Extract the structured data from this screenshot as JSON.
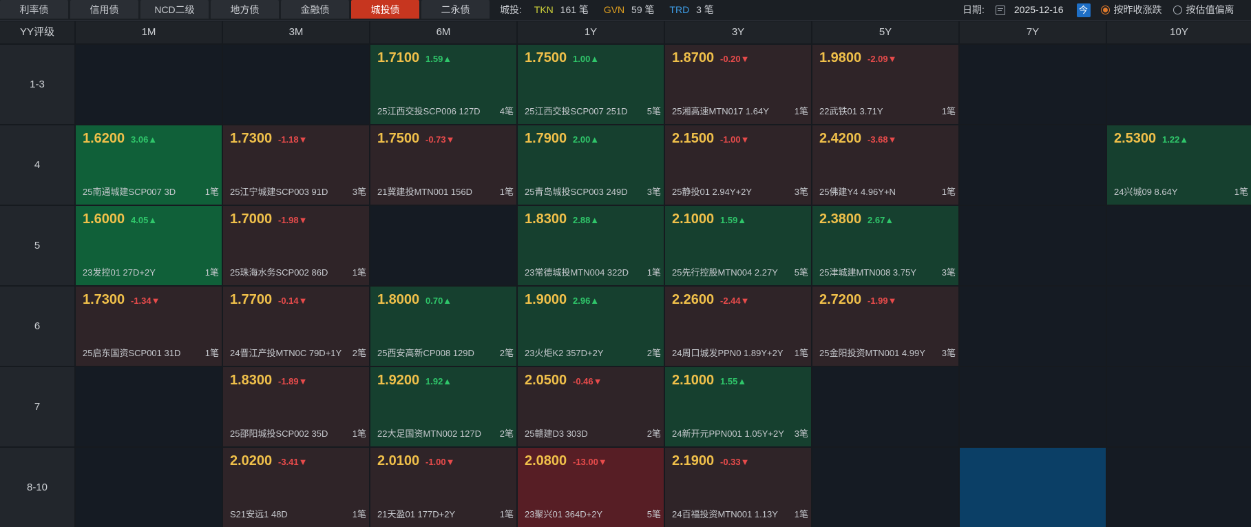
{
  "tabs": [
    {
      "label": "利率债",
      "active": false
    },
    {
      "label": "信用债",
      "active": false
    },
    {
      "label": "NCD二级",
      "active": false
    },
    {
      "label": "地方债",
      "active": false
    },
    {
      "label": "金融债",
      "active": false
    },
    {
      "label": "城投债",
      "active": true
    },
    {
      "label": "二永债",
      "active": false
    }
  ],
  "stats": {
    "label": "城投:",
    "tkn_label": "TKN",
    "tkn_count": "161 笔",
    "gvn_label": "GVN",
    "gvn_count": "59 笔",
    "trd_label": "TRD",
    "trd_count": "3 笔"
  },
  "controls": {
    "date_label": "日期:",
    "date_value": "2025-12-16",
    "today_label": "今",
    "radio_change": "按昨收涨跌",
    "radio_deviation": "按估值偏离",
    "selected_mode": "按昨收涨跌"
  },
  "colors": {
    "active_tab": "#c7361f",
    "yield": "#f0c04a",
    "up": "#2fc66a",
    "down": "#e84b4b",
    "tkn": "#cfd33a",
    "gvn": "#e0a020",
    "trd": "#3e9ee8"
  },
  "grid": {
    "corner_label": "YY评级",
    "columns": [
      "1M",
      "3M",
      "6M",
      "1Y",
      "3Y",
      "5Y",
      "7Y",
      "10Y"
    ],
    "rows": [
      {
        "label": "1-3",
        "cells": [
          null,
          null,
          {
            "yield": "1.7100",
            "change": "1.59▲",
            "dir": "up",
            "bond": "25江西交投SCP006 127D",
            "deals": "4笔"
          },
          {
            "yield": "1.7500",
            "change": "1.00▲",
            "dir": "up",
            "bond": "25江西交投SCP007 251D",
            "deals": "5笔"
          },
          {
            "yield": "1.8700",
            "change": "-0.20▼",
            "dir": "down",
            "bond": "25湘高速MTN017 1.64Y",
            "deals": "1笔"
          },
          {
            "yield": "1.9800",
            "change": "-2.09▼",
            "dir": "down",
            "bond": "22武铁01 3.71Y",
            "deals": "1笔"
          },
          null,
          null
        ]
      },
      {
        "label": "4",
        "cells": [
          {
            "yield": "1.6200",
            "change": "3.06▲",
            "dir": "upS",
            "bond": "25南通城建SCP007 3D",
            "deals": "1笔"
          },
          {
            "yield": "1.7300",
            "change": "-1.18▼",
            "dir": "down",
            "bond": "25江宁城建SCP003 91D",
            "deals": "3笔"
          },
          {
            "yield": "1.7500",
            "change": "-0.73▼",
            "dir": "down",
            "bond": "21冀建投MTN001 156D",
            "deals": "1笔"
          },
          {
            "yield": "1.7900",
            "change": "2.00▲",
            "dir": "up",
            "bond": "25青岛城投SCP003 249D",
            "deals": "3笔"
          },
          {
            "yield": "2.1500",
            "change": "-1.00▼",
            "dir": "down",
            "bond": "25静投01 2.94Y+2Y",
            "deals": "3笔"
          },
          {
            "yield": "2.4200",
            "change": "-3.68▼",
            "dir": "down",
            "bond": "25佛建Y4 4.96Y+N",
            "deals": "1笔"
          },
          null,
          {
            "yield": "2.5300",
            "change": "1.22▲",
            "dir": "up",
            "bond": "24兴城09 8.64Y",
            "deals": "1笔"
          }
        ]
      },
      {
        "label": "5",
        "cells": [
          {
            "yield": "1.6000",
            "change": "4.05▲",
            "dir": "upS",
            "bond": "23发控01 27D+2Y",
            "deals": "1笔"
          },
          {
            "yield": "1.7000",
            "change": "-1.98▼",
            "dir": "down",
            "bond": "25珠海水务SCP002 86D",
            "deals": "1笔"
          },
          null,
          {
            "yield": "1.8300",
            "change": "2.88▲",
            "dir": "up",
            "bond": "23常德城投MTN004 322D",
            "deals": "1笔"
          },
          {
            "yield": "2.1000",
            "change": "1.59▲",
            "dir": "up",
            "bond": "25先行控股MTN004 2.27Y",
            "deals": "5笔"
          },
          {
            "yield": "2.3800",
            "change": "2.67▲",
            "dir": "up",
            "bond": "25津城建MTN008 3.75Y",
            "deals": "3笔"
          },
          null,
          null
        ]
      },
      {
        "label": "6",
        "cells": [
          {
            "yield": "1.7300",
            "change": "-1.34▼",
            "dir": "down",
            "bond": "25启东国资SCP001 31D",
            "deals": "1笔"
          },
          {
            "yield": "1.7700",
            "change": "-0.14▼",
            "dir": "down",
            "bond": "24晋江产投MTN0C 79D+1Y",
            "deals": "2笔"
          },
          {
            "yield": "1.8000",
            "change": "0.70▲",
            "dir": "up",
            "bond": "25西安高新CP008 129D",
            "deals": "2笔"
          },
          {
            "yield": "1.9000",
            "change": "2.96▲",
            "dir": "up",
            "bond": "23火炬K2 357D+2Y",
            "deals": "2笔"
          },
          {
            "yield": "2.2600",
            "change": "-2.44▼",
            "dir": "down",
            "bond": "24周口城发PPN0 1.89Y+2Y",
            "deals": "1笔"
          },
          {
            "yield": "2.7200",
            "change": "-1.99▼",
            "dir": "down",
            "bond": "25金阳投资MTN001 4.99Y",
            "deals": "3笔"
          },
          null,
          null
        ]
      },
      {
        "label": "7",
        "cells": [
          null,
          {
            "yield": "1.8300",
            "change": "-1.89▼",
            "dir": "down",
            "bond": "25邵阳城投SCP002 35D",
            "deals": "1笔"
          },
          {
            "yield": "1.9200",
            "change": "1.92▲",
            "dir": "up",
            "bond": "22大足国资MTN002 127D",
            "deals": "2笔"
          },
          {
            "yield": "2.0500",
            "change": "-0.46▼",
            "dir": "down",
            "bond": "25赣建D3 303D",
            "deals": "2笔"
          },
          {
            "yield": "2.1000",
            "change": "1.55▲",
            "dir": "up",
            "bond": "24新开元PPN001 1.05Y+2Y",
            "deals": "3笔"
          },
          null,
          null,
          null
        ]
      },
      {
        "label": "8-10",
        "cells": [
          null,
          {
            "yield": "2.0200",
            "change": "-3.41▼",
            "dir": "down",
            "bond": "S21安远1 48D",
            "deals": "1笔"
          },
          {
            "yield": "2.0100",
            "change": "-1.00▼",
            "dir": "down",
            "bond": "21天盈01 177D+2Y",
            "deals": "1笔"
          },
          {
            "yield": "2.0800",
            "change": "-13.00▼",
            "dir": "downS",
            "bond": "23聚兴01 364D+2Y",
            "deals": "5笔"
          },
          {
            "yield": "2.1900",
            "change": "-0.33▼",
            "dir": "down",
            "bond": "24百福投资MTN001 1.13Y",
            "deals": "1笔"
          },
          null,
          "selected",
          null
        ]
      }
    ]
  }
}
